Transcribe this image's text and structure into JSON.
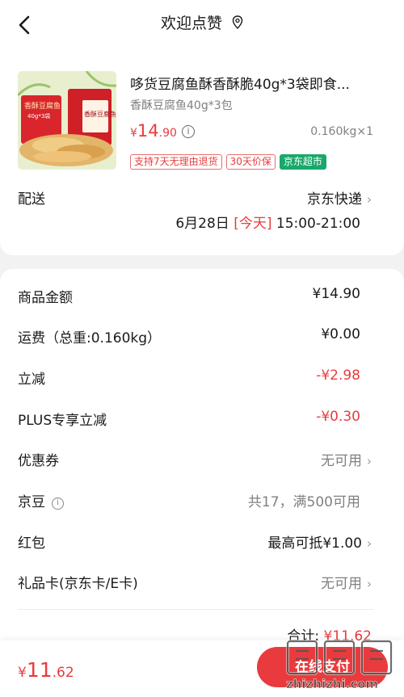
{
  "header": {
    "title": "欢迎点赞",
    "back_icon": "chevron-left-icon",
    "title_icon": "map-pin-icon"
  },
  "product": {
    "name": "哆货豆腐鱼酥香酥脆40g*3袋即食...",
    "spec": "香酥豆腐鱼40g*3包",
    "price_symbol": "¥",
    "price_int": "14",
    "price_dec": ".90",
    "weight_qty": "0.160kg×1",
    "tags": [
      "支持7天无理由退货",
      "30天价保",
      "京东超市"
    ],
    "image_text": {
      "left_pack": "香酥豆腐鱼",
      "left_sub": "40g*3袋",
      "right_pack": "香酥豆腐鱼"
    }
  },
  "shipping": {
    "label": "配送",
    "carrier": "京东快递",
    "date": "6月28日",
    "today": "[今天]",
    "time": "15:00-21:00"
  },
  "summary": {
    "rows": [
      {
        "label": "商品金额",
        "value": "¥14.90"
      },
      {
        "label": "运费（总重:0.160kg）",
        "value": "¥0.00"
      },
      {
        "label": "立减",
        "value": "-¥2.98"
      },
      {
        "label": "PLUS专享立减",
        "value": "-¥0.30"
      },
      {
        "label": "优惠券",
        "value": "无可用"
      },
      {
        "label": "京豆",
        "value": "共17，满500可用"
      },
      {
        "label": "红包",
        "value": "最高可抵¥1.00"
      },
      {
        "label": "礼品卡(京东卡/E卡)",
        "value": "无可用"
      }
    ],
    "total_label": "合计:",
    "total_value": "¥11.62"
  },
  "footer": {
    "price_symbol": "¥",
    "price_int": "11",
    "price_dec": ".62",
    "pay_label": "在线支付"
  },
  "watermark": {
    "text": "值得买",
    "site": "zhizhizhi.com"
  },
  "colors": {
    "accent_red": "#e93b3d",
    "tag_green": "#1aa86b",
    "muted_gray": "#808080"
  }
}
